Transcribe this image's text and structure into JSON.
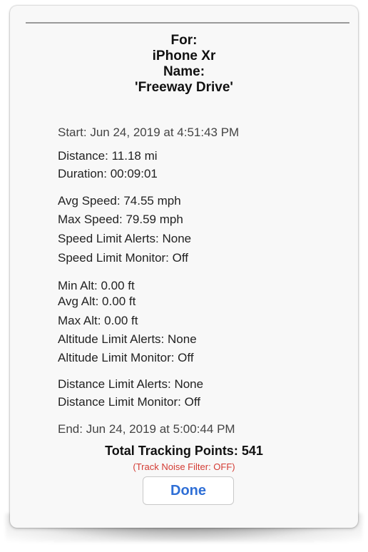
{
  "header": {
    "for_label": "For:",
    "device": "iPhone Xr",
    "name_label": "Name:",
    "name": "'Freeway Drive'"
  },
  "stats": {
    "start": "Start: Jun 24, 2019 at 4:51:43 PM",
    "distance": "Distance:  11.18 mi",
    "duration": "Duration: 00:09:01",
    "avg_speed": "Avg Speed:  74.55 mph",
    "max_speed": "Max Speed:  79.59 mph",
    "speed_alerts": "Speed Limit Alerts: None",
    "speed_monitor": "Speed Limit Monitor: Off",
    "min_alt": "Min Alt:   0.00 ft",
    "avg_alt": "Avg Alt:   0.00 ft",
    "max_alt": "Max Alt:   0.00 ft",
    "alt_alerts": "Altitude Limit Alerts: None",
    "alt_monitor": "Altitude Limit Monitor: Off",
    "dist_alerts": "Distance Limit Alerts: None",
    "dist_monitor": "Distance Limit Monitor: Off",
    "end": "End: Jun 24, 2019 at 5:00:44 PM"
  },
  "footer": {
    "total_points": "Total Tracking Points: 541",
    "noise_filter": "(Track Noise Filter: OFF)",
    "done_label": "Done"
  },
  "colors": {
    "done_button_text": "#2f6fd6",
    "noise_filter_text": "#d33b33"
  }
}
